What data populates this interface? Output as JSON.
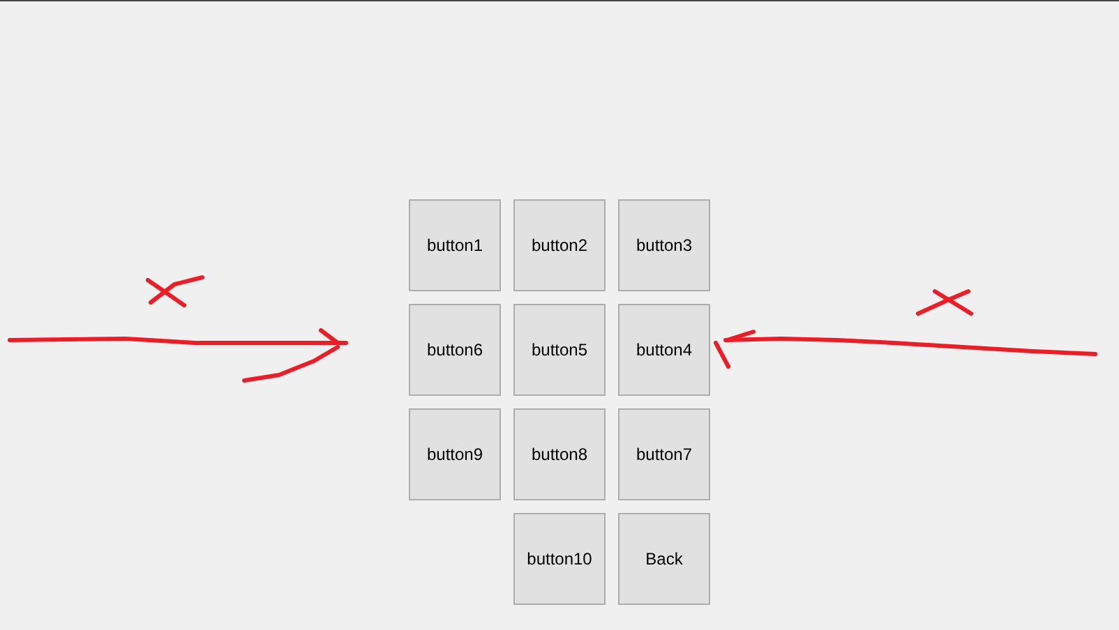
{
  "button_grid": {
    "rows": [
      [
        "button1",
        "button2",
        "button3"
      ],
      [
        "button6",
        "button5",
        "button4"
      ],
      [
        "button9",
        "button8",
        "button7"
      ],
      [
        "",
        "button10",
        "Back"
      ]
    ]
  }
}
